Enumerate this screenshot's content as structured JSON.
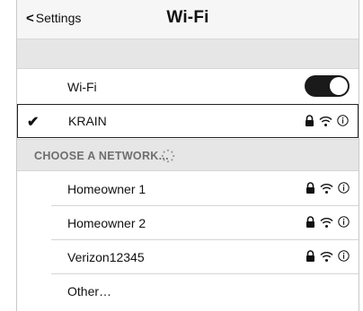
{
  "navbar": {
    "back_label": "Settings",
    "title": "Wi-Fi"
  },
  "wifi_toggle": {
    "label": "Wi-Fi",
    "on": true
  },
  "connected_network": {
    "name": "KRAIN",
    "secured": true
  },
  "section_header": "CHOOSE A NETWORK...",
  "networks": [
    {
      "name": "Homeowner 1",
      "secured": true
    },
    {
      "name": "Homeowner 2",
      "secured": true
    },
    {
      "name": "Verizon12345",
      "secured": true
    }
  ],
  "other_label": "Other…",
  "icons": {
    "back": "chevron-left-icon",
    "check": "checkmark-icon",
    "lock": "lock-icon",
    "wifi": "wifi-signal-icon",
    "info": "info-icon",
    "spinner": "loading-spinner-icon"
  },
  "colors": {
    "toggle_on": "#1a1a1a",
    "section_bg": "#e6e6e6",
    "section_text": "#6e6e6e"
  }
}
